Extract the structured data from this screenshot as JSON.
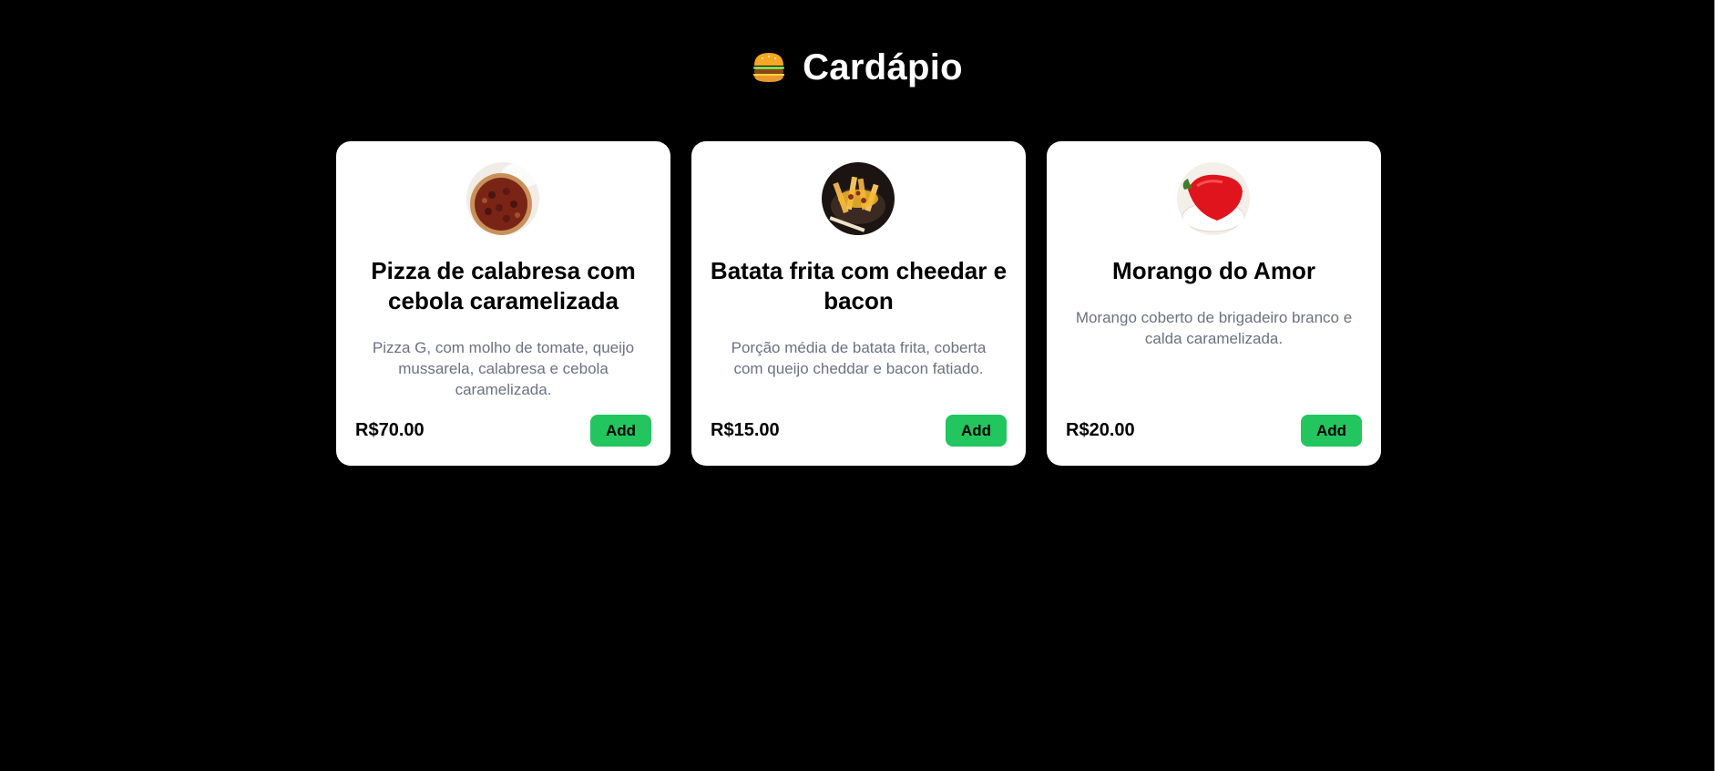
{
  "header": {
    "title": "Cardápio",
    "icon": "hamburger-icon"
  },
  "colors": {
    "background": "#000000",
    "card": "#ffffff",
    "accent": "#22c55e",
    "description": "#6b7280"
  },
  "items": [
    {
      "name": "Pizza de calabresa com cebola caramelizada",
      "description": "Pizza G, com molho de tomate, queijo mussarela, calabresa e cebola caramelizada.",
      "price": "R$70.00",
      "add_label": "Add",
      "image": "pizza-image"
    },
    {
      "name": "Batata frita com cheedar e bacon",
      "description": "Porção média de batata frita, coberta com queijo cheddar e bacon fatiado.",
      "price": "R$15.00",
      "add_label": "Add",
      "image": "fries-image"
    },
    {
      "name": "Morango do Amor",
      "description": "Morango coberto de brigadeiro branco e calda caramelizada.",
      "price": "R$20.00",
      "add_label": "Add",
      "image": "strawberry-image"
    }
  ]
}
